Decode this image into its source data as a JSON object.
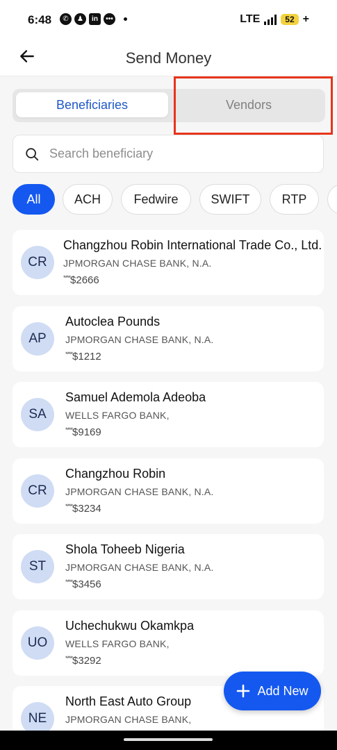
{
  "status_bar": {
    "time": "6:48",
    "network": "LTE",
    "battery": "52",
    "charging": "+"
  },
  "header": {
    "title": "Send Money"
  },
  "tabs": [
    {
      "label": "Beneficiaries",
      "active": true
    },
    {
      "label": "Vendors",
      "active": false
    }
  ],
  "search": {
    "placeholder": "Search beneficiary",
    "value": ""
  },
  "filters": [
    "All",
    "ACH",
    "Fedwire",
    "SWIFT",
    "RTP"
  ],
  "beneficiaries": [
    {
      "initials": "CR",
      "name": "Changzhou Robin International Trade Co., Ltd.",
      "bank": "JPMORGAN CHASE BANK, N.A.",
      "mask": "****",
      "account": "$2666"
    },
    {
      "initials": "AP",
      "name": "Autoclea Pounds",
      "bank": "JPMORGAN CHASE BANK, N.A.",
      "mask": "****",
      "account": "$1212"
    },
    {
      "initials": "SA",
      "name": "Samuel Ademola Adeoba",
      "bank": "WELLS FARGO BANK,",
      "mask": "****",
      "account": "$9169"
    },
    {
      "initials": "CR",
      "name": "Changzhou Robin",
      "bank": "JPMORGAN CHASE BANK, N.A.",
      "mask": "****",
      "account": "$3234"
    },
    {
      "initials": "ST",
      "name": "Shola Toheeb Nigeria",
      "bank": "JPMORGAN CHASE BANK, N.A.",
      "mask": "****",
      "account": "$3456"
    },
    {
      "initials": "UO",
      "name": "Uchechukwu Okamkpa",
      "bank": "WELLS FARGO BANK,",
      "mask": "****",
      "account": "$3292"
    },
    {
      "initials": "NE",
      "name": "North East Auto Group",
      "bank": "JPMORGAN CHASE BANK,",
      "mask": "",
      "account": ""
    }
  ],
  "fab": {
    "label": "Add New"
  },
  "colors": {
    "accent": "#1458f0",
    "tab_active_text": "#1f58c8",
    "highlight": "#e8341c",
    "avatar_bg": "#cfdcf4"
  }
}
